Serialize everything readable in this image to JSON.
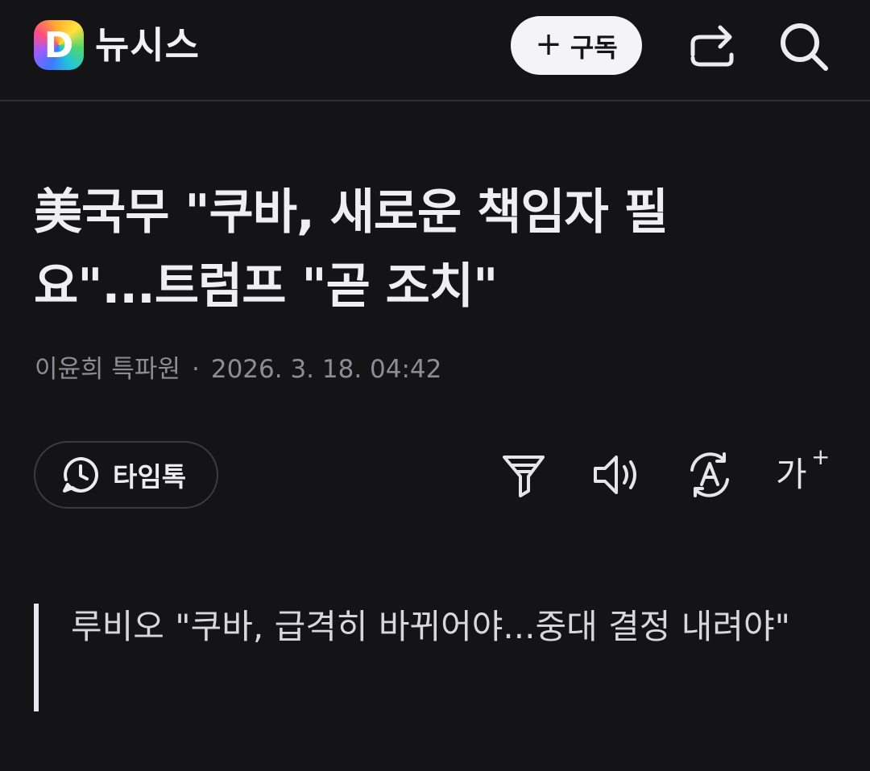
{
  "header": {
    "logo_letter": "D",
    "publisher": "뉴시스",
    "subscribe_plus": "+",
    "subscribe_label": "구독",
    "share_icon": "share-icon",
    "search_icon": "search-icon"
  },
  "article": {
    "title": "美국무 \"쿠바, 새로운 책임자 필요\"...트럼프 \"곧 조치\"",
    "author": "이윤희 특파원",
    "separator": "·",
    "datetime": "2026. 3. 18. 04:42",
    "subtitle": "루비오 \"쿠바, 급격히 바뀌어야...중대 결정 내려야\""
  },
  "toolbar": {
    "timetalk_label": "타임톡",
    "font_label": "가",
    "font_plus": "+",
    "icons": [
      "clock-chat-icon",
      "filter-icon",
      "speaker-icon",
      "translate-icon",
      "font-size-icon"
    ]
  }
}
